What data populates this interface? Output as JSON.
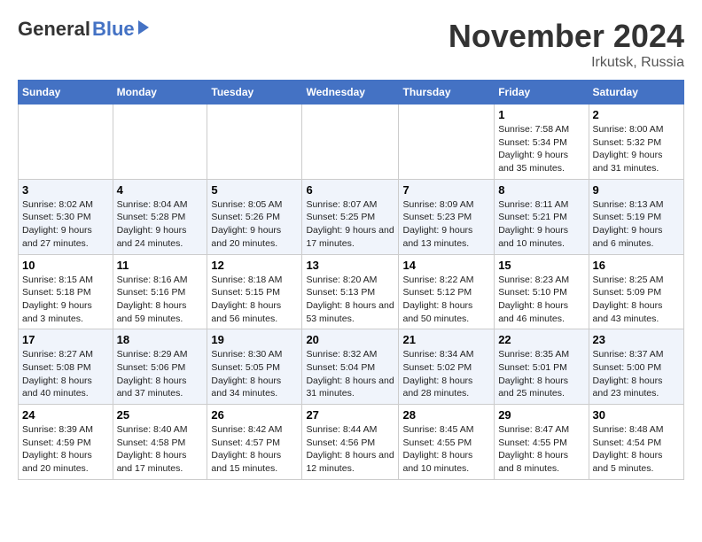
{
  "logo": {
    "general": "General",
    "blue": "Blue"
  },
  "title": "November 2024",
  "location": "Irkutsk, Russia",
  "days_of_week": [
    "Sunday",
    "Monday",
    "Tuesday",
    "Wednesday",
    "Thursday",
    "Friday",
    "Saturday"
  ],
  "weeks": [
    [
      {
        "day": "",
        "info": ""
      },
      {
        "day": "",
        "info": ""
      },
      {
        "day": "",
        "info": ""
      },
      {
        "day": "",
        "info": ""
      },
      {
        "day": "",
        "info": ""
      },
      {
        "day": "1",
        "info": "Sunrise: 7:58 AM\nSunset: 5:34 PM\nDaylight: 9 hours and 35 minutes."
      },
      {
        "day": "2",
        "info": "Sunrise: 8:00 AM\nSunset: 5:32 PM\nDaylight: 9 hours and 31 minutes."
      }
    ],
    [
      {
        "day": "3",
        "info": "Sunrise: 8:02 AM\nSunset: 5:30 PM\nDaylight: 9 hours and 27 minutes."
      },
      {
        "day": "4",
        "info": "Sunrise: 8:04 AM\nSunset: 5:28 PM\nDaylight: 9 hours and 24 minutes."
      },
      {
        "day": "5",
        "info": "Sunrise: 8:05 AM\nSunset: 5:26 PM\nDaylight: 9 hours and 20 minutes."
      },
      {
        "day": "6",
        "info": "Sunrise: 8:07 AM\nSunset: 5:25 PM\nDaylight: 9 hours and 17 minutes."
      },
      {
        "day": "7",
        "info": "Sunrise: 8:09 AM\nSunset: 5:23 PM\nDaylight: 9 hours and 13 minutes."
      },
      {
        "day": "8",
        "info": "Sunrise: 8:11 AM\nSunset: 5:21 PM\nDaylight: 9 hours and 10 minutes."
      },
      {
        "day": "9",
        "info": "Sunrise: 8:13 AM\nSunset: 5:19 PM\nDaylight: 9 hours and 6 minutes."
      }
    ],
    [
      {
        "day": "10",
        "info": "Sunrise: 8:15 AM\nSunset: 5:18 PM\nDaylight: 9 hours and 3 minutes."
      },
      {
        "day": "11",
        "info": "Sunrise: 8:16 AM\nSunset: 5:16 PM\nDaylight: 8 hours and 59 minutes."
      },
      {
        "day": "12",
        "info": "Sunrise: 8:18 AM\nSunset: 5:15 PM\nDaylight: 8 hours and 56 minutes."
      },
      {
        "day": "13",
        "info": "Sunrise: 8:20 AM\nSunset: 5:13 PM\nDaylight: 8 hours and 53 minutes."
      },
      {
        "day": "14",
        "info": "Sunrise: 8:22 AM\nSunset: 5:12 PM\nDaylight: 8 hours and 50 minutes."
      },
      {
        "day": "15",
        "info": "Sunrise: 8:23 AM\nSunset: 5:10 PM\nDaylight: 8 hours and 46 minutes."
      },
      {
        "day": "16",
        "info": "Sunrise: 8:25 AM\nSunset: 5:09 PM\nDaylight: 8 hours and 43 minutes."
      }
    ],
    [
      {
        "day": "17",
        "info": "Sunrise: 8:27 AM\nSunset: 5:08 PM\nDaylight: 8 hours and 40 minutes."
      },
      {
        "day": "18",
        "info": "Sunrise: 8:29 AM\nSunset: 5:06 PM\nDaylight: 8 hours and 37 minutes."
      },
      {
        "day": "19",
        "info": "Sunrise: 8:30 AM\nSunset: 5:05 PM\nDaylight: 8 hours and 34 minutes."
      },
      {
        "day": "20",
        "info": "Sunrise: 8:32 AM\nSunset: 5:04 PM\nDaylight: 8 hours and 31 minutes."
      },
      {
        "day": "21",
        "info": "Sunrise: 8:34 AM\nSunset: 5:02 PM\nDaylight: 8 hours and 28 minutes."
      },
      {
        "day": "22",
        "info": "Sunrise: 8:35 AM\nSunset: 5:01 PM\nDaylight: 8 hours and 25 minutes."
      },
      {
        "day": "23",
        "info": "Sunrise: 8:37 AM\nSunset: 5:00 PM\nDaylight: 8 hours and 23 minutes."
      }
    ],
    [
      {
        "day": "24",
        "info": "Sunrise: 8:39 AM\nSunset: 4:59 PM\nDaylight: 8 hours and 20 minutes."
      },
      {
        "day": "25",
        "info": "Sunrise: 8:40 AM\nSunset: 4:58 PM\nDaylight: 8 hours and 17 minutes."
      },
      {
        "day": "26",
        "info": "Sunrise: 8:42 AM\nSunset: 4:57 PM\nDaylight: 8 hours and 15 minutes."
      },
      {
        "day": "27",
        "info": "Sunrise: 8:44 AM\nSunset: 4:56 PM\nDaylight: 8 hours and 12 minutes."
      },
      {
        "day": "28",
        "info": "Sunrise: 8:45 AM\nSunset: 4:55 PM\nDaylight: 8 hours and 10 minutes."
      },
      {
        "day": "29",
        "info": "Sunrise: 8:47 AM\nSunset: 4:55 PM\nDaylight: 8 hours and 8 minutes."
      },
      {
        "day": "30",
        "info": "Sunrise: 8:48 AM\nSunset: 4:54 PM\nDaylight: 8 hours and 5 minutes."
      }
    ]
  ]
}
